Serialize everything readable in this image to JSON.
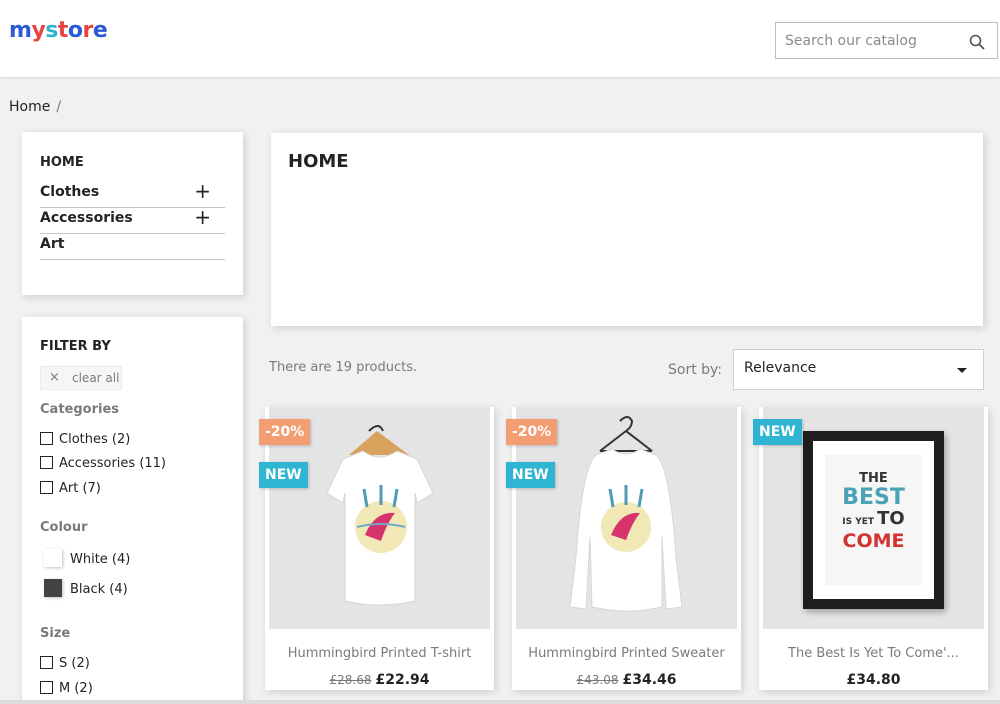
{
  "header": {
    "logo_letters": [
      "m",
      "y",
      " ",
      "s",
      "t",
      "o",
      "r",
      "e"
    ],
    "search_placeholder": "Search our catalog",
    "search_icon": "search-icon"
  },
  "breadcrumb": {
    "home": "Home",
    "separator": "/"
  },
  "categories": {
    "title": "HOME",
    "items": [
      {
        "label": "Clothes",
        "expand": "+"
      },
      {
        "label": "Accessories",
        "expand": "+"
      },
      {
        "label": "Art",
        "expand": ""
      }
    ]
  },
  "filters": {
    "title": "FILTER BY",
    "clear_icon": "×",
    "clear_all": "clear all",
    "categories_title": "Categories",
    "categories": [
      "Clothes (2)",
      "Accessories (11)",
      "Art (7)"
    ],
    "colour_title": "Colour",
    "colours": [
      {
        "label": "White (4)",
        "color": "#ffffff"
      },
      {
        "label": "Black (4)",
        "color": "#434343"
      }
    ],
    "size_title": "Size",
    "sizes": [
      "S (2)",
      "M (2)"
    ]
  },
  "main": {
    "title": "HOME",
    "product_count": "There are 19 products.",
    "sort_label": "Sort by:",
    "sort_value": "Relevance"
  },
  "products": [
    {
      "name": "Hummingbird Printed T-shirt",
      "old_price": "£28.68",
      "price": "£22.94",
      "discount": "-20%",
      "new": "NEW"
    },
    {
      "name": "Hummingbird Printed Sweater",
      "old_price": "£43.08",
      "price": "£34.46",
      "discount": "-20%",
      "new": "NEW"
    },
    {
      "name": "The Best Is Yet To Come'...",
      "old_price": "",
      "price": "£34.80",
      "discount": "",
      "new": "NEW"
    }
  ],
  "poster": {
    "line1": "THE",
    "line2": "BEST",
    "line3a": "IS YET",
    "line3b": "TO",
    "line4": "COME"
  },
  "colors": {
    "accent": "#2fb5d2",
    "discount": "#f39d72",
    "logo_blue": "#2a5bd7",
    "logo_red": "#e8433f"
  }
}
